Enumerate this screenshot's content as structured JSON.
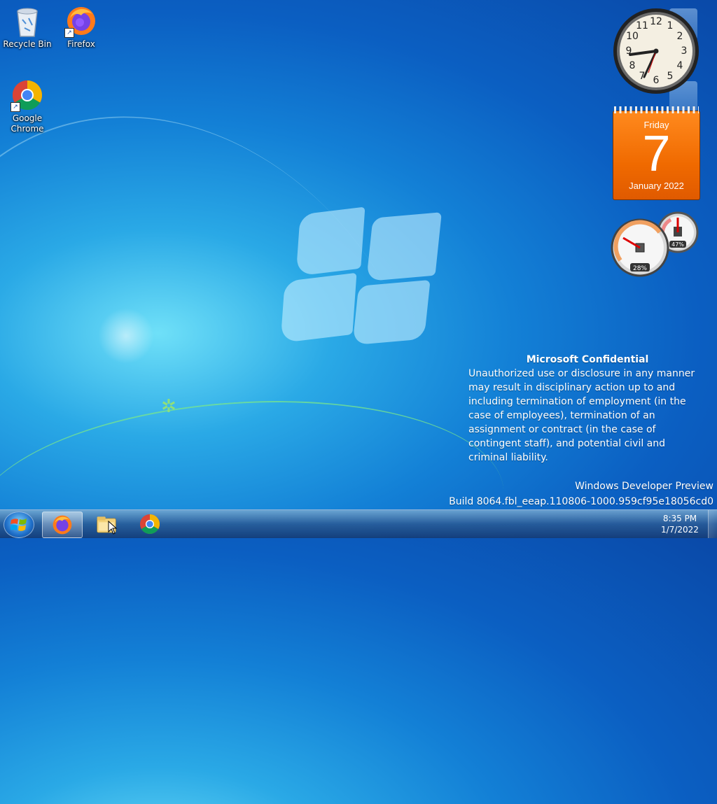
{
  "desktop_icons": [
    {
      "label": "Recycle Bin",
      "icon": "recycle-bin-icon"
    },
    {
      "label": "Firefox",
      "icon": "firefox-icon"
    },
    {
      "label": "Google Chrome",
      "icon": "chrome-icon"
    }
  ],
  "calendar_gadget": {
    "day": "Friday",
    "date": "7",
    "month_year": "January 2022"
  },
  "clock_gadget": {
    "hour_numerals": [
      "12",
      "1",
      "2",
      "3",
      "4",
      "5",
      "6",
      "7",
      "8",
      "9",
      "10",
      "11"
    ],
    "icon": "analog-clock-icon"
  },
  "cpu_meter_gadget": {
    "cpu_percent": "28%",
    "memory_percent": "47%"
  },
  "confidential_notice": {
    "title": "Microsoft Confidential",
    "body": "Unauthorized use or disclosure in any manner may result in disciplinary action up to and including termination of employment (in the case of employees), termination of an assignment or contract (in the case of contingent staff), and potential civil and criminal liability."
  },
  "watermark": {
    "line1": "Windows Developer Preview",
    "line2": "Build 8064.fbl_eeap.110806-1000.959cf95e18056cd0"
  },
  "taskbar": {
    "start_icon": "windows-start-icon",
    "pinned": [
      {
        "name": "Firefox",
        "icon": "firefox-icon",
        "active": true
      },
      {
        "name": "Windows Explorer",
        "icon": "folder-icon",
        "active": false
      },
      {
        "name": "Google Chrome",
        "icon": "chrome-icon",
        "active": false
      }
    ],
    "time": "8:35 PM",
    "date": "1/7/2022"
  },
  "colors": {
    "calendar_orange": "#f06a00",
    "wallpaper_blue": "#1380d6"
  }
}
